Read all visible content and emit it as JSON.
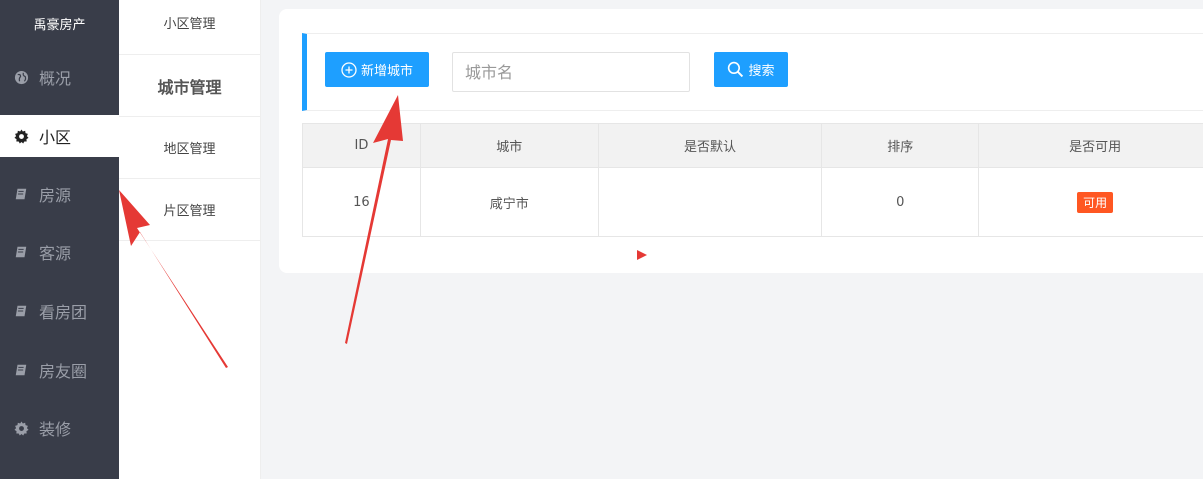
{
  "sidebar": {
    "brand": "禹豪房产",
    "items": [
      {
        "label": "概况",
        "icon": "globe-icon"
      },
      {
        "label": "小区",
        "icon": "gear-icon"
      },
      {
        "label": "房源",
        "icon": "book-icon"
      },
      {
        "label": "客源",
        "icon": "book-icon"
      },
      {
        "label": "看房团",
        "icon": "book-icon"
      },
      {
        "label": "房友圈",
        "icon": "book-icon"
      },
      {
        "label": "装修",
        "icon": "gear-icon"
      }
    ],
    "active_index": 1
  },
  "submenu": {
    "items": [
      "小区管理",
      "城市管理",
      "地区管理",
      "片区管理"
    ],
    "active_index": 1
  },
  "toolbar": {
    "add_label": "新增城市",
    "search_placeholder": "城市名",
    "search_label": "搜索"
  },
  "table": {
    "headers": [
      "ID",
      "城市",
      "是否默认",
      "排序",
      "是否可用"
    ],
    "rows": [
      {
        "id": "16",
        "city": "咸宁市",
        "default": "",
        "sort": "0",
        "available": "可用"
      }
    ]
  },
  "colors": {
    "sidebar_bg": "#393d49",
    "accent": "#1e9fff",
    "badge": "#ff5722",
    "annotation": "#e53935"
  }
}
